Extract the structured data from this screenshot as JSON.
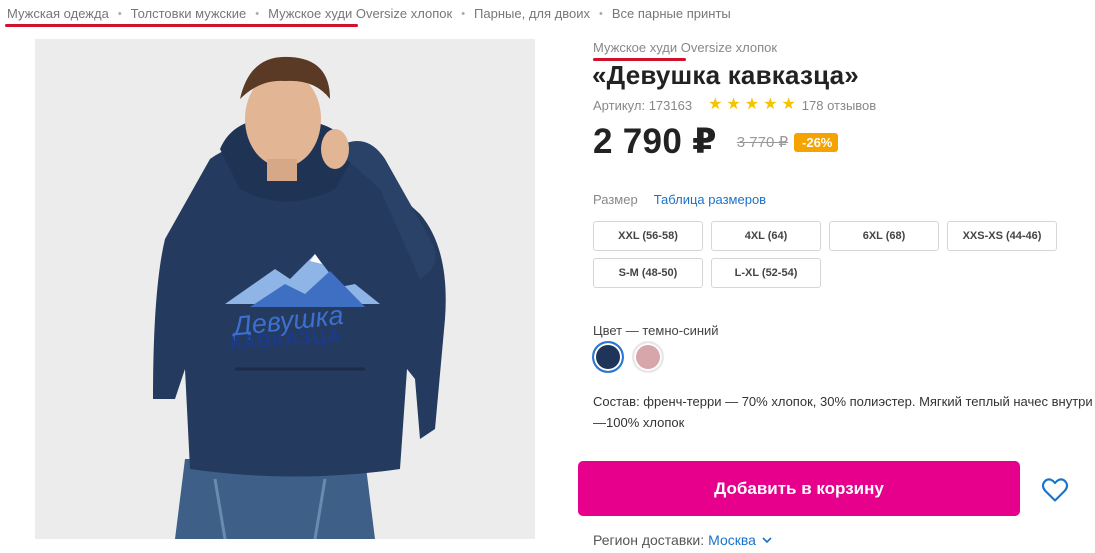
{
  "breadcrumbs": [
    {
      "label": "Мужская одежда"
    },
    {
      "label": "Толстовки мужские"
    },
    {
      "label": "Мужское худи Oversize хлопок"
    },
    {
      "label": "Парные, для двоих"
    },
    {
      "label": "Все парные принты"
    }
  ],
  "product": {
    "category": "Мужское худи Oversize хлопок",
    "title": "«Девушка кавказца»",
    "article": "Артикул: 173163",
    "rating": 5,
    "reviews": "178 отзывов",
    "price": "2 790 ₽",
    "old_price": "3 770 ₽",
    "discount": "-26%",
    "print_line1": "Девушка",
    "print_line2": "КАВКАЗЦА"
  },
  "size": {
    "label": "Размер",
    "table_link": "Таблица размеров",
    "options": [
      "XXL (56-58)",
      "4XL (64)",
      "6XL (68)",
      "XXS-XS (44-46)",
      "S-M (48-50)",
      "L-XL (52-54)"
    ]
  },
  "color": {
    "label": "Цвет — темно-синий",
    "swatches": [
      {
        "name": "темно-синий",
        "hex": "#1e3458",
        "selected": true
      },
      {
        "name": "розовый",
        "hex": "#d6a6ab",
        "selected": false
      }
    ]
  },
  "composition": "Состав: френч-терри — 70% хлопок, 30% полиэстер. Мягкий теплый начес внутри —100% хлопок",
  "cart": {
    "label": "Добавить в корзину"
  },
  "region": {
    "label": "Регион доставки:",
    "city": "Москва"
  },
  "colors": {
    "accent": "#e6008c",
    "link": "#1a73c9",
    "star": "#f5c400",
    "discount": "#f5a300",
    "underline": "#d0112b"
  }
}
